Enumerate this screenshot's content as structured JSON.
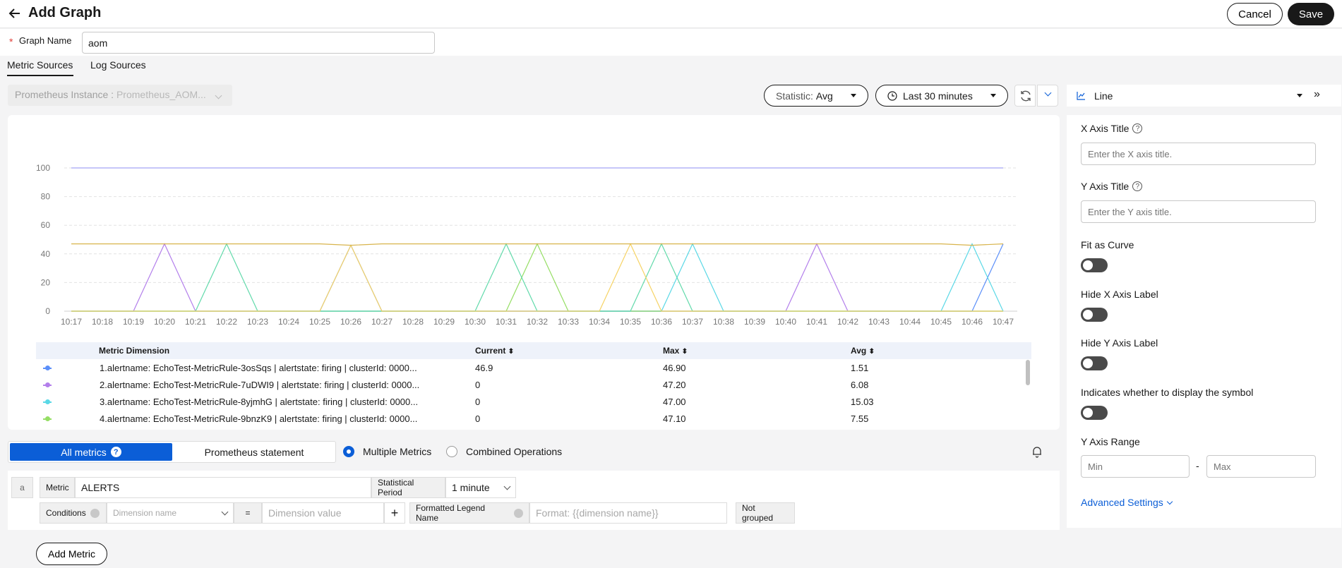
{
  "header": {
    "title": "Add Graph",
    "cancel_label": "Cancel",
    "save_label": "Save"
  },
  "graph_name": {
    "label": "Graph Name",
    "value": "aom"
  },
  "tabs": [
    {
      "label": "Metric Sources"
    },
    {
      "label": "Log Sources"
    }
  ],
  "toolbar": {
    "prometheus_label": "Prometheus Instance :",
    "prometheus_value": "Prometheus_AOM...",
    "statistic_label": "Statistic:",
    "statistic_value": "Avg",
    "time_range": "Last 30 minutes"
  },
  "chart_data": {
    "type": "line",
    "x": [
      "10:17",
      "10:18",
      "10:19",
      "10:20",
      "10:21",
      "10:22",
      "10:23",
      "10:24",
      "10:25",
      "10:26",
      "10:27",
      "10:28",
      "10:29",
      "10:30",
      "10:31",
      "10:32",
      "10:33",
      "10:34",
      "10:35",
      "10:36",
      "10:37",
      "10:38",
      "10:39",
      "10:40",
      "10:41",
      "10:42",
      "10:43",
      "10:44",
      "10:45",
      "10:46",
      "10:47"
    ],
    "yticks": [
      0,
      20,
      40,
      60,
      80,
      100
    ],
    "ylim": [
      0,
      100
    ],
    "grid": true,
    "series": [
      {
        "color": "#5b8ff9",
        "values": [
          0,
          0,
          0,
          0,
          0,
          0,
          0,
          0,
          0,
          46,
          0,
          0,
          0,
          0,
          0,
          0,
          0,
          0,
          0,
          0,
          0,
          0,
          0,
          0,
          0,
          0,
          0,
          0,
          0,
          0,
          46.9
        ]
      },
      {
        "color": "#b37feb",
        "values": [
          0,
          0,
          0,
          47,
          0,
          0,
          0,
          0,
          0,
          0,
          0,
          0,
          0,
          0,
          0,
          0,
          0,
          0,
          0,
          0,
          0,
          0,
          0,
          0,
          47,
          0,
          0,
          0,
          0,
          0,
          0
        ]
      },
      {
        "color": "#5ad8e6",
        "values": [
          0,
          0,
          0,
          0,
          0,
          0,
          0,
          0,
          0,
          0,
          0,
          0,
          0,
          0,
          0,
          0,
          0,
          0,
          0,
          0,
          47,
          0,
          0,
          0,
          0,
          0,
          0,
          0,
          0,
          47,
          0
        ]
      },
      {
        "color": "#95de64",
        "values": [
          0,
          0,
          0,
          0,
          0,
          0,
          0,
          0,
          0,
          0,
          0,
          0,
          0,
          0,
          0,
          47,
          0,
          0,
          0,
          0,
          0,
          0,
          0,
          0,
          0,
          0,
          0,
          0,
          0,
          0,
          0
        ]
      },
      {
        "color": "#62daab",
        "values": [
          0,
          0,
          0,
          0,
          0,
          47,
          0,
          0,
          0,
          0,
          0,
          0,
          0,
          0,
          47,
          0,
          0,
          0,
          0,
          47,
          0,
          0,
          0,
          0,
          0,
          0,
          0,
          0,
          0,
          0,
          0
        ]
      },
      {
        "color": "#f6d365",
        "values": [
          0,
          0,
          0,
          0,
          0,
          0,
          0,
          0,
          0,
          46,
          0,
          0,
          0,
          0,
          0,
          0,
          0,
          0,
          47,
          0,
          0,
          0,
          0,
          0,
          0,
          0,
          0,
          0,
          0,
          0,
          0
        ]
      },
      {
        "color": "#d8b44c",
        "values": [
          47,
          47,
          47,
          47,
          47,
          47,
          47,
          47,
          47,
          46,
          47,
          47,
          47,
          47,
          47,
          47,
          47,
          47,
          47,
          47,
          47,
          47,
          47,
          47,
          47,
          47,
          47,
          47,
          47,
          46,
          47
        ]
      },
      {
        "color": "#a3a3f5",
        "values": [
          100,
          100,
          100,
          100,
          100,
          100,
          100,
          100,
          100,
          100,
          100,
          100,
          100,
          100,
          100,
          100,
          100,
          100,
          100,
          100,
          100,
          100,
          100,
          100,
          100,
          100,
          100,
          100,
          100,
          100,
          100
        ]
      }
    ]
  },
  "legend_table": {
    "headers": {
      "dimension": "Metric Dimension",
      "current": "Current",
      "max": "Max",
      "avg": "Avg"
    },
    "rows": [
      {
        "color": "#5b8ff9",
        "dimension": "1.alertname: EchoTest-MetricRule-3osSqs | alertstate: firing | clusterId: 0000...",
        "current": "46.9",
        "max": "46.90",
        "avg": "1.51"
      },
      {
        "color": "#b37feb",
        "dimension": "2.alertname: EchoTest-MetricRule-7uDWI9 | alertstate: firing | clusterId: 0000...",
        "current": "0",
        "max": "47.20",
        "avg": "6.08"
      },
      {
        "color": "#5ad8e6",
        "dimension": "3.alertname: EchoTest-MetricRule-8yjmhG | alertstate: firing | clusterId: 0000...",
        "current": "0",
        "max": "47.00",
        "avg": "15.03"
      },
      {
        "color": "#95de64",
        "dimension": "4.alertname: EchoTest-MetricRule-9bnzK9 | alertstate: firing | clusterId: 0000...",
        "current": "0",
        "max": "47.10",
        "avg": "7.55"
      }
    ]
  },
  "metric_mode": {
    "all_metrics": "All metrics",
    "prom_statement": "Prometheus statement",
    "multiple_metrics": "Multiple Metrics",
    "combined_operations": "Combined Operations"
  },
  "query": {
    "alias": "a",
    "metric_label": "Metric",
    "metric_value": "ALERTS",
    "period_label": "Statistical Period",
    "period_value": "1 minute",
    "conditions_label": "Conditions",
    "dimension_placeholder": "Dimension name",
    "operator": "=",
    "value_placeholder": "Dimension value",
    "legend_label": "Formatted Legend Name",
    "legend_placeholder": "Format: {{dimension name}}",
    "group_label": "Not grouped"
  },
  "add_metric_label": "Add Metric",
  "right_panel": {
    "chart_type": "Line",
    "x_axis_title": "X Axis Title",
    "x_axis_placeholder": "Enter the X axis title.",
    "y_axis_title": "Y Axis Title",
    "y_axis_placeholder": "Enter the Y axis title.",
    "fit_curve": "Fit as Curve",
    "hide_x": "Hide X Axis Label",
    "hide_y": "Hide Y Axis Label",
    "display_symbol": "Indicates whether to display the symbol",
    "y_range": "Y Axis Range",
    "min_placeholder": "Min",
    "max_placeholder": "Max",
    "range_sep": "-",
    "advanced": "Advanced Settings"
  }
}
